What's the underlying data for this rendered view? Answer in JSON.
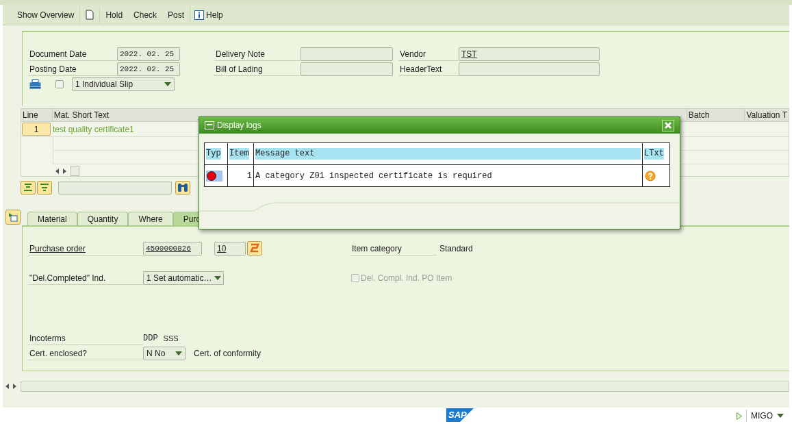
{
  "toolbar": [
    {
      "kind": "text",
      "label": "Show Overview"
    },
    {
      "kind": "document"
    },
    {
      "kind": "text",
      "label": "Hold"
    },
    {
      "kind": "text",
      "label": "Check"
    },
    {
      "kind": "text",
      "label": "Post"
    },
    {
      "kind": "help",
      "label": "Help"
    }
  ],
  "header": {
    "left": [
      {
        "label": "Document Date",
        "value": "2022. 02. 25"
      },
      {
        "label": "Posting Date",
        "value": "2022. 02. 25"
      }
    ],
    "middle": [
      {
        "label": "Delivery Note"
      },
      {
        "label": "Bill of Lading"
      }
    ],
    "right": [
      {
        "label": "Vendor",
        "value": "TST"
      },
      {
        "label": "HeaderText"
      }
    ],
    "slip": {
      "checked": false,
      "value": "1 Individual Slip"
    }
  },
  "table": {
    "columns": [
      {
        "label": "Line"
      },
      {
        "label": "Mat. Short Text"
      },
      {
        "label": "Batch"
      },
      {
        "label": "Valuation T"
      }
    ],
    "rows": [
      {
        "line": "1",
        "text": "test quality certificate1"
      }
    ]
  },
  "tabs": [
    {
      "label": "Material",
      "selected": false
    },
    {
      "label": "Quantity",
      "selected": false
    },
    {
      "label": "Where",
      "selected": false
    },
    {
      "label": "Purc",
      "selected": true
    }
  ],
  "detail": {
    "purchase_order": {
      "label": "Purchase order",
      "value": "4500000826",
      "item": "10"
    },
    "item_category": {
      "label": "Item category",
      "value": "Standard"
    },
    "del_completed": {
      "label": "\"Del.Completed\" Ind.",
      "value": "1 Set automatic…"
    },
    "del_compl_po_item": {
      "label": "Del. Compl. Ind. PO Item",
      "checked": false,
      "disabled": true
    },
    "incoterms": {
      "label": "Incoterms",
      "value": "DDP",
      "value2": "SSS"
    },
    "cert_enclosed": {
      "label": "Cert. enclosed?",
      "value": "N No",
      "description": "Cert. of conformity"
    }
  },
  "dialog": {
    "title": "Display logs",
    "columns": [
      "Typ",
      "Item",
      "Message text",
      "LTxt"
    ],
    "messages": [
      {
        "kind": "error",
        "item": "1",
        "text": "A category Z01 inspected certificate is required"
      }
    ]
  },
  "status_bar": {
    "logo": "SAP",
    "transaction": "MIGO"
  }
}
